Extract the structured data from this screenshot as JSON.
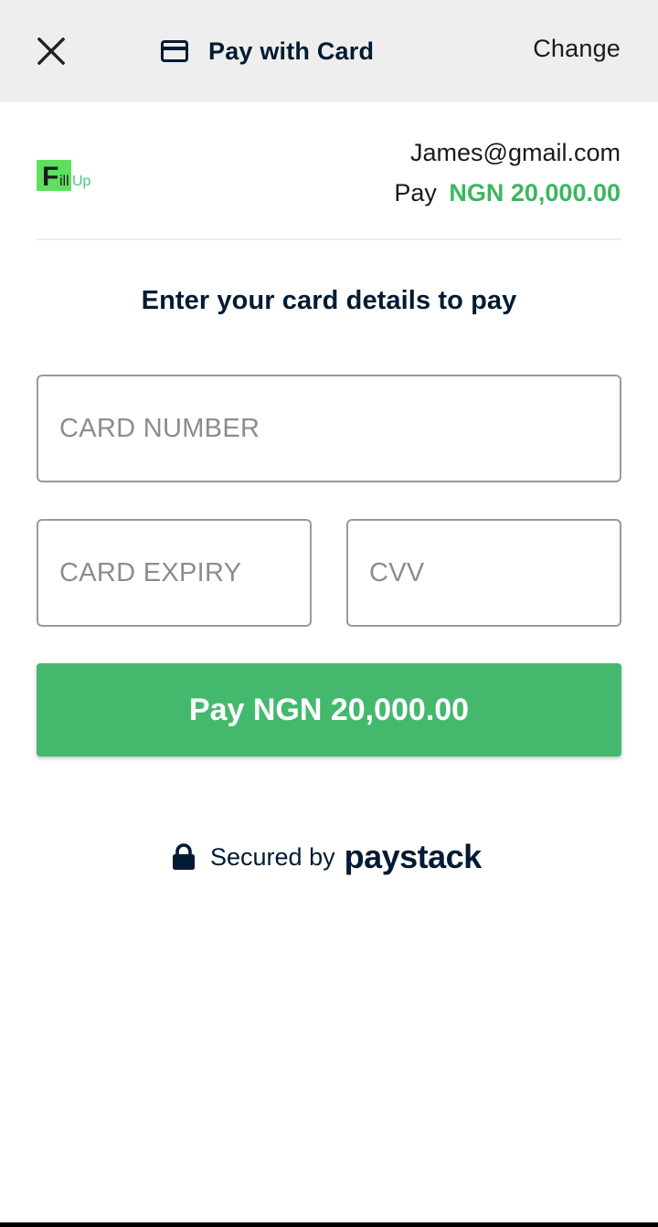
{
  "header": {
    "title": "Pay with Card",
    "change_label": "Change"
  },
  "merchant": {
    "logo_letter": "F",
    "logo_text_dark": "ill",
    "logo_text_accent": "Up",
    "email": "James@gmail.com",
    "pay_label": "Pay",
    "amount": "NGN 20,000.00"
  },
  "form": {
    "instruction": "Enter your card details to pay",
    "card_number_placeholder": "CARD NUMBER",
    "card_expiry_placeholder": "CARD EXPIRY",
    "cvv_placeholder": "CVV",
    "pay_button_label": "Pay NGN 20,000.00"
  },
  "footer": {
    "secured_text": "Secured by",
    "brand": "paystack"
  },
  "colors": {
    "accent_green": "#44b96e",
    "amount_green": "#3bb75e",
    "navy": "#011b33",
    "header_bg": "#eeeeee"
  },
  "icons": {
    "close": "close-icon",
    "card": "credit-card-icon",
    "lock": "lock-icon"
  }
}
